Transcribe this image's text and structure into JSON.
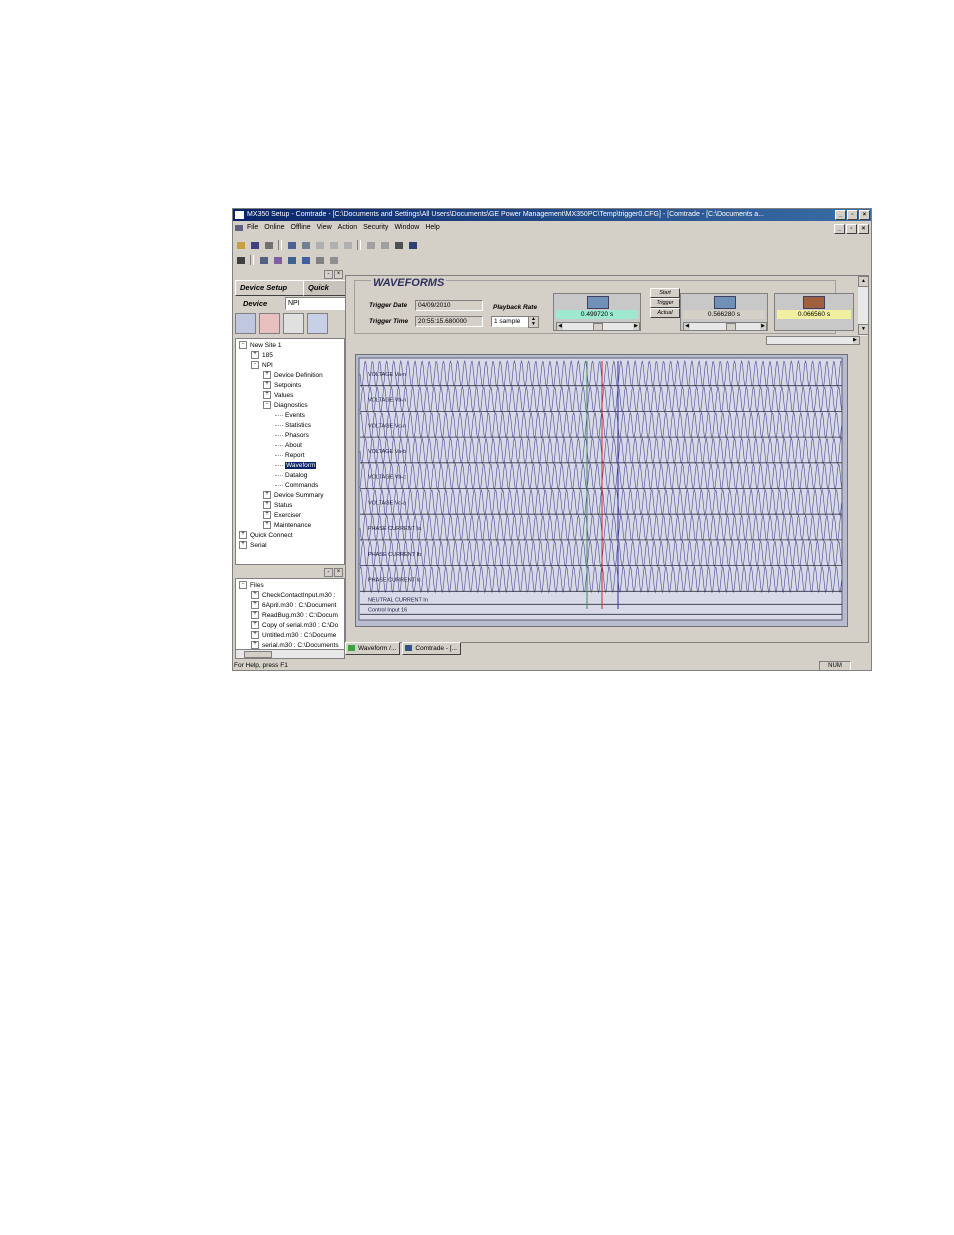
{
  "window": {
    "title": "MX350 Setup  - Comtrade - [C:\\Documents and Settings\\All Users\\Documents\\GE Power Management\\MX350PC\\Temp\\trigger0.CFG] - [Comtrade - [C:\\Documents a..."
  },
  "menu": [
    "File",
    "Online",
    "Offline",
    "View",
    "Action",
    "Security",
    "Window",
    "Help"
  ],
  "left_tabs": {
    "device_setup": "Device Setup",
    "quick": "Quick"
  },
  "device": {
    "label": "Device",
    "value": "NPI"
  },
  "tree": [
    {
      "label": "New Site 1",
      "level": 0,
      "toggle": "-"
    },
    {
      "label": "185",
      "level": 1,
      "toggle": "+"
    },
    {
      "label": "NPI",
      "level": 1,
      "toggle": "-"
    },
    {
      "label": "Device Definition",
      "level": 2,
      "toggle": "+"
    },
    {
      "label": "Setpoints",
      "level": 2,
      "toggle": "+"
    },
    {
      "label": "Values",
      "level": 2,
      "toggle": "+"
    },
    {
      "label": "Diagnostics",
      "level": 2,
      "toggle": "-"
    },
    {
      "label": "Events",
      "level": 3,
      "toggle": ""
    },
    {
      "label": "Statistics",
      "level": 3,
      "toggle": ""
    },
    {
      "label": "Phasors",
      "level": 3,
      "toggle": ""
    },
    {
      "label": "About",
      "level": 3,
      "toggle": ""
    },
    {
      "label": "Report",
      "level": 3,
      "toggle": ""
    },
    {
      "label": "Waveform",
      "level": 3,
      "toggle": "",
      "selected": true
    },
    {
      "label": "Datalog",
      "level": 3,
      "toggle": ""
    },
    {
      "label": "Commands",
      "level": 3,
      "toggle": ""
    },
    {
      "label": "Device Summary",
      "level": 2,
      "toggle": "+"
    },
    {
      "label": "Status",
      "level": 2,
      "toggle": "+"
    },
    {
      "label": "Exerciser",
      "level": 2,
      "toggle": "+"
    },
    {
      "label": "Maintenance",
      "level": 2,
      "toggle": "+"
    },
    {
      "label": "Quick Connect",
      "level": 0,
      "toggle": "+"
    },
    {
      "label": "Serial",
      "level": 0,
      "toggle": "+"
    }
  ],
  "files": [
    {
      "label": "Files",
      "level": 0,
      "toggle": "-"
    },
    {
      "label": "CheckContactInput.m30 :",
      "level": 1,
      "toggle": "+"
    },
    {
      "label": "6April.m30 : C:\\Document",
      "level": 1,
      "toggle": "+"
    },
    {
      "label": "ReadBug.m30 : C:\\Docum",
      "level": 1,
      "toggle": "+"
    },
    {
      "label": "Copy of serial.m30 : C:\\Do",
      "level": 1,
      "toggle": "+"
    },
    {
      "label": "Untitled.m30 : C:\\Docume",
      "level": 1,
      "toggle": "+"
    },
    {
      "label": "serial.m30 : C:\\Documents",
      "level": 1,
      "toggle": "+"
    }
  ],
  "waveforms": {
    "title": "WAVEFORMS",
    "trigger_date_label": "Trigger Date",
    "trigger_date": "04/09/2010",
    "trigger_time_label": "Trigger Time",
    "trigger_time": "20:55:15.680000",
    "playback_label": "Playback Rate",
    "playback_value": "1 sample",
    "cursor1": "0.499720 s",
    "cursor2": "0.566280 s",
    "delta": "0.066560 s",
    "start_btn": "Start",
    "trigger_btn": "Trigger",
    "actual_btn": "Actual",
    "cursor1_color": "#9ee8d0",
    "delta_color": "#f0f0a0",
    "channels": [
      "VOLTAGE Va-n",
      "VOLTAGE Vb-n",
      "VOLTAGE Vc-n",
      "VOLTAGE Va-b",
      "VOLTAGE Vb-c",
      "VOLTAGE Vc-a",
      "PHASE CURRENT Ia",
      "PHASE CURRENT Ib",
      "PHASE CURRENT Ic"
    ],
    "digital_channels": [
      "NEUTRAL CURRENT In",
      "Control Input 16"
    ]
  },
  "task_tabs": [
    "Waveform /...",
    "Comtrade - [..."
  ],
  "status": {
    "help": "For Help, press F1",
    "num": "NUM"
  }
}
